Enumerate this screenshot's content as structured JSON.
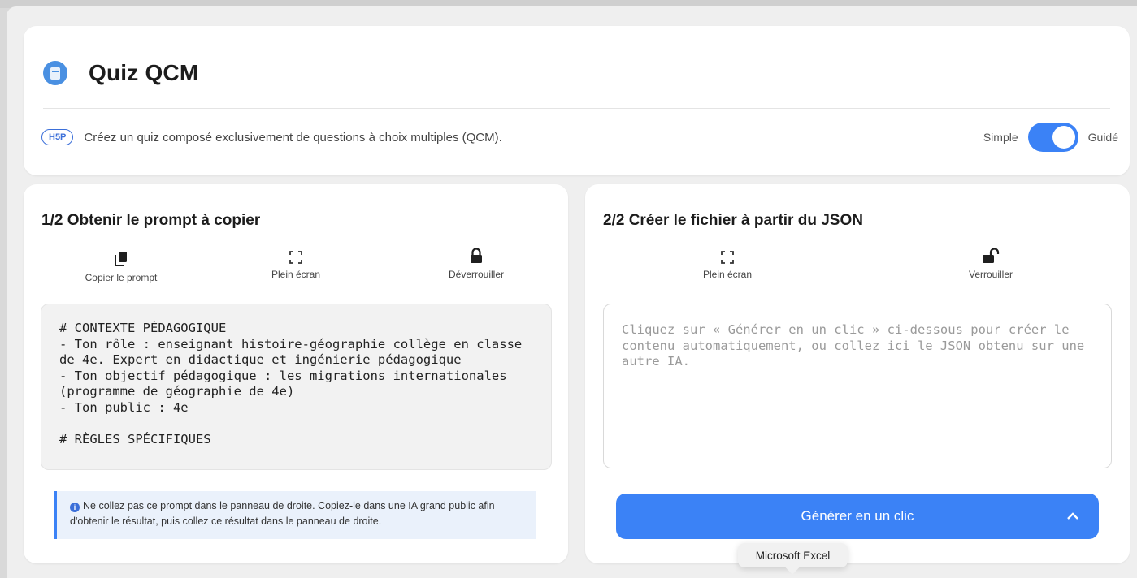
{
  "header": {
    "title": "Quiz QCM",
    "badge": "H5P",
    "description": "Créez un quiz composé exclusivement de questions à choix multiples (QCM).",
    "mode_left": "Simple",
    "mode_right": "Guidé",
    "toggle_state": "on"
  },
  "left_panel": {
    "title": "1/2 Obtenir le prompt à copier",
    "tools": {
      "copy": "Copier le prompt",
      "fullscreen": "Plein écran",
      "unlock": "Déverrouiller"
    },
    "prompt_text": "# CONTEXTE PÉDAGOGIQUE\n- Ton rôle : enseignant histoire-géographie collège en classe de 4e. Expert en didactique et ingénierie pédagogique\n- Ton objectif pédagogique : les migrations internationales (programme de géographie de 4e)\n- Ton public : 4e\n\n# RÈGLES SPÉCIFIQUES",
    "info": "Ne collez pas ce prompt dans le panneau de droite. Copiez-le dans une IA grand public afin d'obtenir le résultat, puis collez ce résultat dans le panneau de droite."
  },
  "right_panel": {
    "title": "2/2 Créer le fichier à partir du JSON",
    "tools": {
      "fullscreen": "Plein écran",
      "lock": "Verrouiller"
    },
    "json_placeholder": "Cliquez sur « Générer en un clic » ci-dessous pour créer le contenu automatiquement, ou collez ici le JSON obtenu sur une autre IA.",
    "generate_label": "Générer en un clic"
  },
  "tooltip": "Microsoft Excel",
  "colors": {
    "accent": "#3b82f6",
    "badge": "#3b6fd9",
    "info_bg": "#eaf1fb"
  }
}
